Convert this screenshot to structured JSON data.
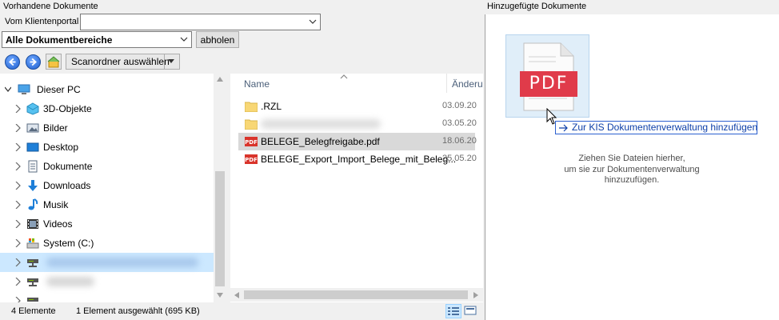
{
  "left_header": {
    "title": "Vorhandene Dokumente",
    "portal_label": "Vom Klientenportal",
    "portal_value": "",
    "area_value": "Alle Dokumentbereiche",
    "fetch_button": "abholen",
    "scan_button": "Scanordner auswählen"
  },
  "tree": {
    "root": "Dieser PC",
    "items": [
      {
        "label": "3D-Objekte",
        "icon": "3d-objects-icon"
      },
      {
        "label": "Bilder",
        "icon": "pictures-icon"
      },
      {
        "label": "Desktop",
        "icon": "desktop-icon"
      },
      {
        "label": "Dokumente",
        "icon": "documents-icon"
      },
      {
        "label": "Downloads",
        "icon": "downloads-icon"
      },
      {
        "label": "Musik",
        "icon": "music-icon"
      },
      {
        "label": "Videos",
        "icon": "videos-icon"
      },
      {
        "label": "System (C:)",
        "icon": "drive-icon"
      }
    ]
  },
  "files": {
    "col_name": "Name",
    "col_changed": "Änderu",
    "rows": [
      {
        "name": ".RZL",
        "date": "03.09.20",
        "type": "folder"
      },
      {
        "name": "",
        "date": "03.05.20",
        "type": "folder"
      },
      {
        "name": "BELEGE_Belegfreigabe.pdf",
        "date": "18.06.20",
        "type": "pdf"
      },
      {
        "name": "BELEGE_Export_Import_Belege_mit_Beleg...",
        "date": "25.05.20",
        "type": "pdf"
      }
    ]
  },
  "status": {
    "count": "4 Elemente",
    "selection": "1 Element ausgewählt (695 KB)"
  },
  "right_pane": {
    "title": "Hinzugefügte Dokumente",
    "pdf_label": "PDF",
    "tooltip": "Zur KIS Dokumentenverwaltung hinzufügen",
    "hint_line1": "Ziehen Sie Dateien hierher,",
    "hint_line2": "um sie zur Dokumentenverwaltung",
    "hint_line3": "hinzuzufügen."
  },
  "colors": {
    "selection": "#cce8ff",
    "pdf_red": "#e03b4a",
    "tooltip_blue": "#0d3fa8"
  }
}
